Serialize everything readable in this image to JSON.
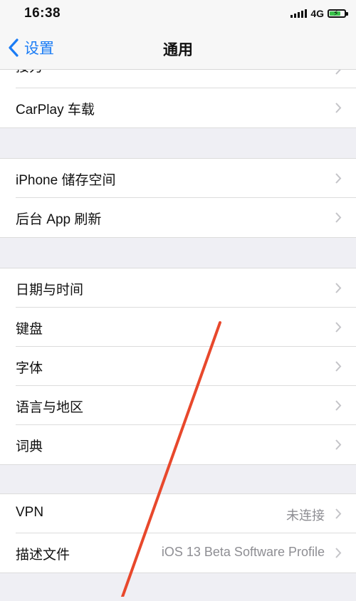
{
  "status_bar": {
    "time": "16:38",
    "network": "4G",
    "signal_icon": "signal-bars-icon",
    "battery_icon": "battery-charging-icon",
    "battery_color": "#39c24a"
  },
  "nav": {
    "back_label": "设置",
    "title": "通用",
    "accent_color": "#1a7cf5"
  },
  "groups": [
    {
      "rows": [
        {
          "label": "接力",
          "value": ""
        },
        {
          "label": "CarPlay 车载",
          "value": ""
        }
      ]
    },
    {
      "rows": [
        {
          "label": "iPhone 储存空间",
          "value": ""
        },
        {
          "label": "后台 App 刷新",
          "value": ""
        }
      ]
    },
    {
      "rows": [
        {
          "label": "日期与时间",
          "value": ""
        },
        {
          "label": "键盘",
          "value": ""
        },
        {
          "label": "字体",
          "value": ""
        },
        {
          "label": "语言与地区",
          "value": ""
        },
        {
          "label": "词典",
          "value": ""
        }
      ]
    },
    {
      "rows": [
        {
          "label": "VPN",
          "value": "未连接"
        },
        {
          "label": "描述文件",
          "value": "iOS 13 Beta Software Profile"
        }
      ]
    }
  ],
  "annotation": {
    "type": "red-arrow",
    "color": "#e8482c",
    "points_to": "描述文件"
  }
}
